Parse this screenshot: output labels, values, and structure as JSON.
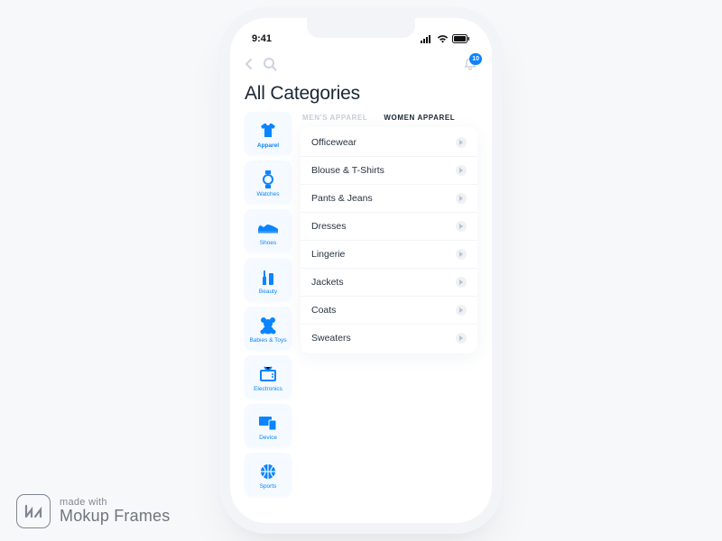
{
  "statusbar": {
    "time": "9:41"
  },
  "header": {
    "badge": "10"
  },
  "title": "All Categories",
  "sidebar": {
    "items": [
      {
        "label": "Apparel"
      },
      {
        "label": "Watches"
      },
      {
        "label": "Shoes"
      },
      {
        "label": "Beauty"
      },
      {
        "label": "Babies & Toys"
      },
      {
        "label": "Electronics"
      },
      {
        "label": "Device"
      },
      {
        "label": "Sports"
      }
    ]
  },
  "tabs": {
    "items": [
      {
        "label": "MEN'S APPAREL"
      },
      {
        "label": "WOMEN APPAREL"
      }
    ]
  },
  "list": {
    "items": [
      {
        "label": "Officewear"
      },
      {
        "label": "Blouse & T-Shirts"
      },
      {
        "label": "Pants & Jeans"
      },
      {
        "label": "Dresses"
      },
      {
        "label": "Lingerie"
      },
      {
        "label": "Jackets"
      },
      {
        "label": "Coats"
      },
      {
        "label": "Sweaters"
      }
    ]
  },
  "watermark": {
    "line1": "made with",
    "line2": "Mokup Frames"
  }
}
